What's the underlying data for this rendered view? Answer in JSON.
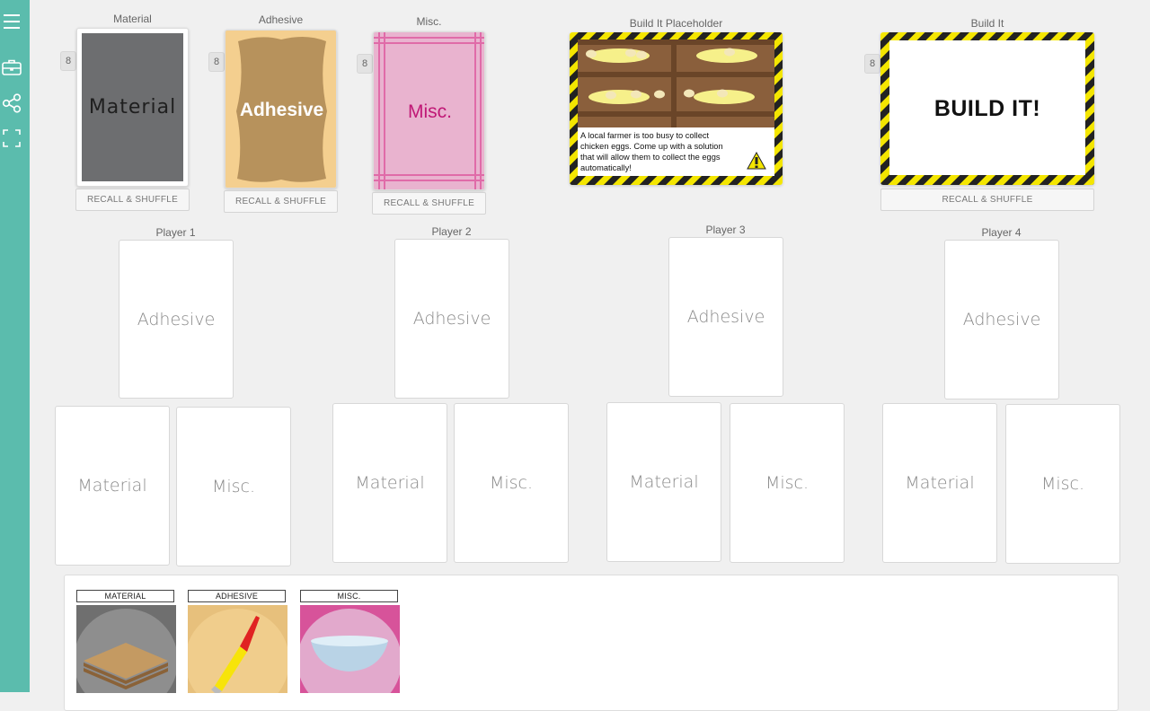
{
  "sidebar": {
    "icons": [
      "menu-icon",
      "briefcase-icon",
      "share-icon",
      "fullscreen-icon"
    ]
  },
  "decks": {
    "material": {
      "label": "Material",
      "count": "8",
      "face": "Material",
      "button": "RECALL & SHUFFLE"
    },
    "adhesive": {
      "label": "Adhesive",
      "count": "8",
      "face": "Adhesive",
      "button": "RECALL & SHUFFLE"
    },
    "misc": {
      "label": "Misc.",
      "count": "8",
      "face": "Misc.",
      "button": "RECALL & SHUFFLE"
    },
    "build_placeholder": {
      "label": "Build It Placeholder",
      "text": "A local farmer is too busy to collect chicken eggs. Come up with a solution that will allow them to collect the eggs automatically!"
    },
    "build_it": {
      "label": "Build It",
      "count": "8",
      "face": "BUILD IT!",
      "button": "RECALL & SHUFFLE"
    }
  },
  "players": [
    {
      "name": "Player 1",
      "top": "Adhesive",
      "left": "Material",
      "right": "Misc."
    },
    {
      "name": "Player 2",
      "top": "Adhesive",
      "left": "Material",
      "right": "Misc."
    },
    {
      "name": "Player 3",
      "top": "Adhesive",
      "left": "Material",
      "right": "Misc."
    },
    {
      "name": "Player 4",
      "top": "Adhesive",
      "left": "Material",
      "right": "Misc."
    }
  ],
  "panel": {
    "cards": [
      {
        "title": "MATERIAL",
        "color": "#8e8e8e"
      },
      {
        "title": "ADHESIVE",
        "color": "#f0cd8c"
      },
      {
        "title": "MISC.",
        "color": "#e2a9cc"
      }
    ]
  },
  "colors": {
    "sidebar": "#5bbcad",
    "material_card": "#6d6e70",
    "adhesive_bg": "#f4cf8f",
    "misc_bg": "#e9b3cf",
    "misc_text": "#c01876",
    "hazard_yellow": "#f4e600"
  }
}
